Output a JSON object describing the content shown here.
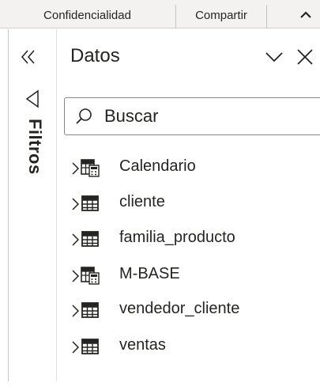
{
  "topbar": {
    "confidentiality_label": "Confidencialidad",
    "share_label": "Compartir",
    "collapse_icon": "chevron-up-icon"
  },
  "filters": {
    "label": "Filtros",
    "expand_icon": "double-chevron-left-icon",
    "filter_icon": "filter-icon"
  },
  "data_pane": {
    "title": "Datos",
    "search": {
      "placeholder": "Buscar",
      "value": ""
    },
    "tables": [
      {
        "label": "Calendario",
        "icon": "calculated-table-icon"
      },
      {
        "label": "cliente",
        "icon": "table-icon"
      },
      {
        "label": "familia_producto",
        "icon": "table-icon"
      },
      {
        "label": "M-BASE",
        "icon": "calculated-table-icon"
      },
      {
        "label": "vendedor_cliente",
        "icon": "table-icon"
      },
      {
        "label": "ventas",
        "icon": "table-icon"
      }
    ]
  },
  "colors": {
    "text": "#252423",
    "topbar_bg": "#f3f2f1",
    "border": "#8a8886"
  }
}
